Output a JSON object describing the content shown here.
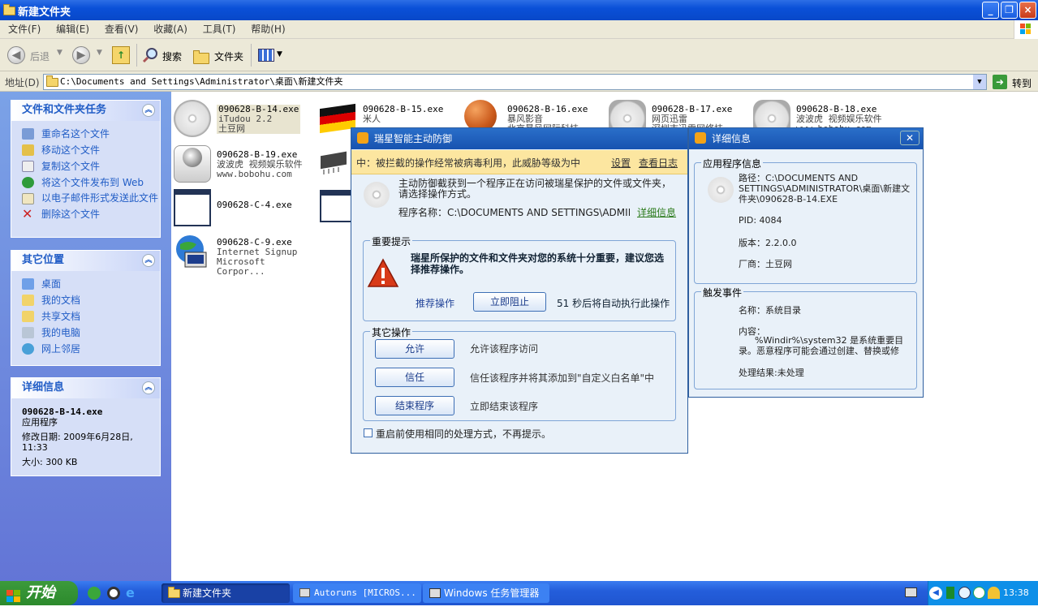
{
  "window": {
    "title": "新建文件夹"
  },
  "menu": [
    "文件(F)",
    "编辑(E)",
    "查看(V)",
    "收藏(A)",
    "工具(T)",
    "帮助(H)"
  ],
  "toolbar": {
    "back": "后退",
    "search": "搜索",
    "folders": "文件夹"
  },
  "address": {
    "label": "地址(D)",
    "path": "C:\\Documents and Settings\\Administrator\\桌面\\新建文件夹",
    "go": "转到"
  },
  "tasks_panel": {
    "title": "文件和文件夹任务",
    "items": [
      "重命名这个文件",
      "移动这个文件",
      "复制这个文件",
      "将这个文件发布到 Web",
      "以电子邮件形式发送此文件",
      "删除这个文件"
    ]
  },
  "places_panel": {
    "title": "其它位置",
    "items": [
      "桌面",
      "我的文档",
      "共享文档",
      "我的电脑",
      "网上邻居"
    ]
  },
  "details_panel": {
    "title": "详细信息",
    "name": "090628-B-14.exe",
    "type": "应用程序",
    "modified": "修改日期: 2009年6月28日, 11:33",
    "size": "大小: 300 KB"
  },
  "files": [
    {
      "name": "090628-B-14.exe",
      "l2": "iTudou 2.2",
      "l3": "土豆网"
    },
    {
      "name": "090628-B-15.exe",
      "l2": "米人",
      "l3": ""
    },
    {
      "name": "090628-B-16.exe",
      "l2": "暴风影音",
      "l3": "北京暴风网际科技..."
    },
    {
      "name": "090628-B-17.exe",
      "l2": "网页迅雷",
      "l3": "深圳市迅雷网络技..."
    },
    {
      "name": "090628-B-18.exe",
      "l2": "波波虎 视频娱乐软件",
      "l3": "www.bobohu.com"
    },
    {
      "name": "090628-B-19.exe",
      "l2": "波波虎 视频娱乐软件",
      "l3": "www.bobohu.com"
    },
    {
      "name": "090628-C-4.exe",
      "l2": "",
      "l3": ""
    },
    {
      "name": "090628-C-9.exe",
      "l2": "Internet Signup",
      "l3": "Microsoft Corpor..."
    }
  ],
  "dialog": {
    "title": "瑞星智能主动防御",
    "threat": "中：被拦截的操作经常被病毒利用，此威胁等级为中",
    "settings": "设置",
    "log": "查看日志",
    "desc": "主动防御截获到一个程序正在访问被瑞星保护的文件或文件夹，请选择操作方式。",
    "program": "程序名称：C:\\DOCUMENTS AND SETTINGS\\ADMINISTRA",
    "details_link": "详细信息",
    "important_label": "重要提示",
    "important_text": "瑞星所保护的文件和文件夹对您的系统十分重要，建议您选择推荐操作。",
    "recommend": "推荐操作",
    "block_btn": "立即阻止",
    "countdown": "51 秒后将自动执行此操作",
    "other_label": "其它操作",
    "allow_btn": "允许",
    "allow_desc": "允许该程序访问",
    "trust_btn": "信任",
    "trust_desc": "信任该程序并将其添加到\"自定义白名单\"中",
    "kill_btn": "结束程序",
    "kill_desc": "立即结束该程序",
    "remember": "重启前使用相同的处理方式，不再提示。"
  },
  "detail": {
    "title": "详细信息",
    "app_label": "应用程序信息",
    "path": "路径：C:\\DOCUMENTS AND SETTINGS\\ADMINISTRATOR\\桌面\\新建文件夹\\090628-B-14.EXE",
    "pid": "PID: 4084",
    "version": "版本：2.2.0.0",
    "vendor": "厂商：土豆网",
    "event_label": "触发事件",
    "event_name": "名称：系统目录",
    "content_label": "内容：",
    "content_text": "%Windir%\\system32 是系统重要目录。恶意程序可能会通过创建、替换或修",
    "result": "处理结果:未处理"
  },
  "taskbar": {
    "start": "开始",
    "tasks": [
      "新建文件夹",
      "Autoruns [MICROS...",
      "Windows 任务管理器"
    ],
    "clock": "13:38"
  }
}
